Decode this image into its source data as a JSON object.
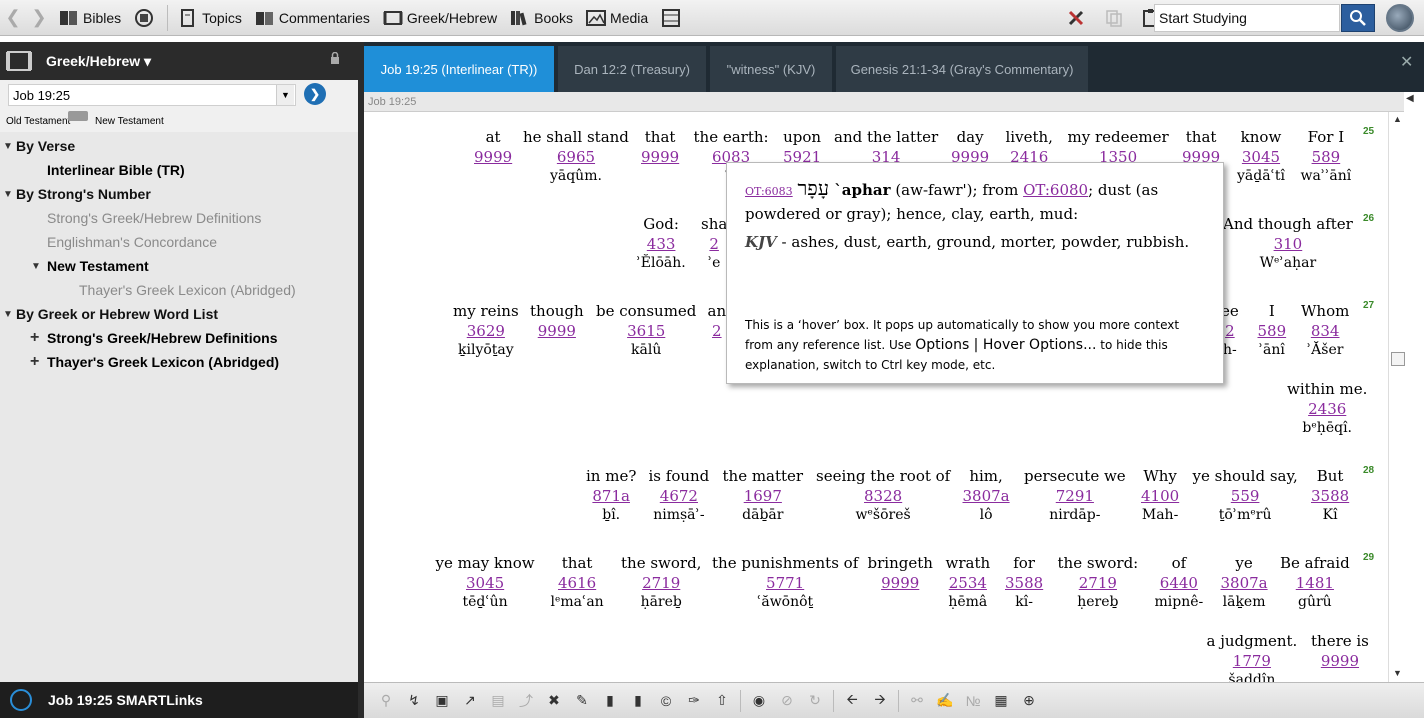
{
  "toolbar": {
    "bibles": "Bibles",
    "topics": "Topics",
    "commentaries": "Commentaries",
    "greek_hebrew": "Greek/Hebrew",
    "books": "Books",
    "media": "Media",
    "search_value": "Start Studying"
  },
  "left_panel": {
    "title": "Greek/Hebrew ▾",
    "reference": "Job 19:25",
    "old_testament": "Old Testament",
    "new_testament": "New Testament",
    "tree": [
      "By Verse",
      "Interlinear Bible (TR)",
      "By Strong's Number",
      "Strong's Greek/Hebrew Definitions",
      "Englishman's Concordance",
      "New Testament",
      "Thayer's Greek Lexicon (Abridged)",
      "By Greek or Hebrew Word List",
      "Strong's Greek/Hebrew Definitions",
      "Thayer's Greek Lexicon (Abridged)"
    ],
    "footer": "Job 19:25 SMARTLinks"
  },
  "tabs": [
    "Job 19:25 (Interlinear (TR))",
    "Dan 12:2 (Treasury)",
    "\"witness\" (KJV)",
    "Genesis 21:1-34 (Gray's Commentary)"
  ],
  "content_header": "Job 19:25",
  "verse_numbers": [
    "25",
    "26",
    "27",
    "28",
    "29"
  ],
  "interlinear": [
    [
      "at",
      "9999",
      "",
      493,
      127
    ],
    [
      "he shall stand",
      "6965",
      "yāqûm.",
      576,
      127
    ],
    [
      "that",
      "9999",
      "",
      660,
      127
    ],
    [
      "the earth:",
      "6083",
      "ʿā",
      731,
      127
    ],
    [
      "upon",
      "5921",
      "",
      802,
      127
    ],
    [
      "and the latter",
      "314",
      "",
      886,
      127
    ],
    [
      "day",
      "9999",
      "",
      970,
      127
    ],
    [
      "liveth,",
      "2416",
      "",
      1029,
      127
    ],
    [
      "my redeemer",
      "1350",
      "",
      1118,
      127
    ],
    [
      "that",
      "9999",
      "",
      1201,
      127
    ],
    [
      "know",
      "3045",
      "yāḏāʿtî",
      1261,
      127
    ],
    [
      "For I",
      "589",
      "waʾʾānî",
      1326,
      127
    ],
    [
      "God:",
      "433",
      "ʾĔlōāh.",
      661,
      214
    ],
    [
      "sha",
      "2",
      "ʾe",
      714,
      214
    ],
    [
      "And though after",
      "310",
      "Wᵉʾaḥar",
      1288,
      214
    ],
    [
      "my reins",
      "3629",
      "ḵilyōṯay",
      486,
      301
    ],
    [
      "though",
      "9999",
      "",
      557,
      301
    ],
    [
      "be consumed",
      "3615",
      "kālû",
      646,
      301
    ],
    [
      "an",
      "2",
      "",
      717,
      301
    ],
    [
      "ee",
      "2",
      "h-",
      1230,
      301
    ],
    [
      "I",
      "589",
      "ʾānî",
      1272,
      301
    ],
    [
      "Whom",
      "834",
      "ʾĂšer",
      1325,
      301
    ],
    [
      "within me.",
      "2436",
      "bᵉḥēqî.",
      1327,
      379
    ],
    [
      "in me?",
      "871a",
      "ḇî.",
      611,
      466
    ],
    [
      "is found",
      "4672",
      "nimṣāʾ-",
      679,
      466
    ],
    [
      "the matter",
      "1697",
      "dāḇār",
      763,
      466
    ],
    [
      "seeing the root of",
      "8328",
      "wᵉšōreš",
      883,
      466
    ],
    [
      "him,",
      "3807a",
      "lô",
      986,
      466
    ],
    [
      "persecute we",
      "7291",
      "nirdāp-",
      1075,
      466
    ],
    [
      "Why",
      "4100",
      "Mah-",
      1160,
      466
    ],
    [
      "ye should say,",
      "559",
      "ṯōʾmᵉrû",
      1245,
      466
    ],
    [
      "But",
      "3588",
      "Kî",
      1330,
      466
    ],
    [
      "ye may know",
      "3045",
      "tēḏʿûn",
      485,
      553
    ],
    [
      "that",
      "4616",
      "lᵉmaʿan",
      577,
      553
    ],
    [
      "the sword,",
      "2719",
      "ḥāreḇ",
      661,
      553
    ],
    [
      "the punishments of",
      "5771",
      "ʿăwōnôṯ",
      785,
      553
    ],
    [
      "bringeth",
      "9999",
      "",
      900,
      553
    ],
    [
      "wrath",
      "2534",
      "ḥēmâ",
      968,
      553
    ],
    [
      "for",
      "3588",
      "kî-",
      1024,
      553
    ],
    [
      "the sword:",
      "2719",
      "ḥereḇ",
      1098,
      553
    ],
    [
      "of",
      "6440",
      "mipnê-",
      1179,
      553
    ],
    [
      "ye",
      "3807a",
      "lāḵem",
      1244,
      553
    ],
    [
      "Be afraid",
      "1481",
      "gûrû",
      1315,
      553
    ],
    [
      "a judgment.",
      "1779",
      "šaddîn",
      1252,
      631
    ],
    [
      "there is",
      "9999",
      "",
      1340,
      631
    ]
  ],
  "hover": {
    "ot_ref": "OT:6083",
    "hebrew": "עָפָר",
    "headword": " `aphar",
    "pron": " (aw-fawr'); from ",
    "from_ref": "OT:6080",
    "def": "; dust (as powdered or gray); hence, clay, earth, mud:",
    "kjv_label": "KJV",
    "kjv_text": " - ashes, dust, earth, ground, morter, powder, rubbish.",
    "expl1": "This is a ‘hover’ box.  It pops up automatically to show you more context from any reference list.  Use ",
    "expl_opt": "Options | Hover Options...",
    "expl2": " to hide this explanation, switch to Ctrl key mode, etc."
  },
  "colors": {
    "accent_tab": "#1f8fd8",
    "strongs_link": "#8a2b9e",
    "verse_number": "#3a8a2a"
  }
}
